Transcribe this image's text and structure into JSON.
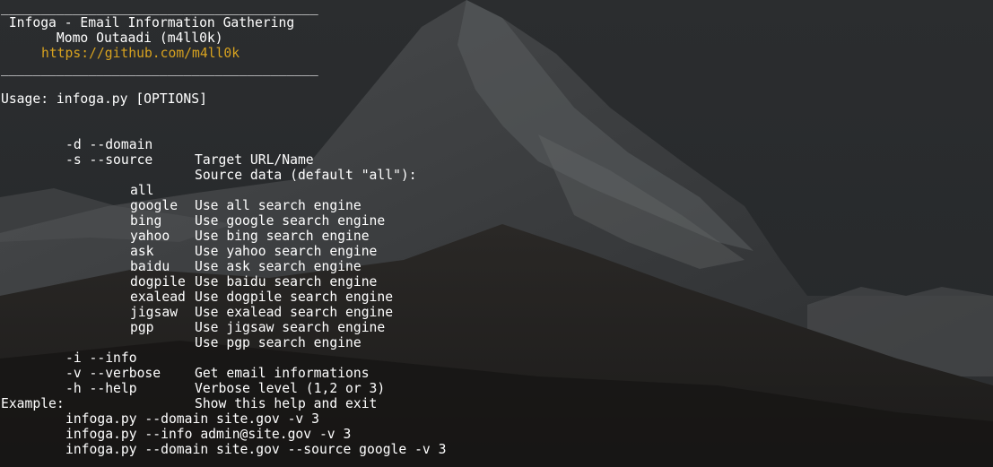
{
  "header": {
    "separator_top": "________________________________________",
    "title": " Infoga - Email Information Gathering",
    "author": "       Momo Outaadi (m4ll0k)",
    "url": "https://github.com/m4ll0k",
    "separator_bottom": "________________________________________"
  },
  "usage": "Usage: infoga.py [OPTIONS]",
  "main_options": [
    {
      "flag": "-d --domain",
      "desc": "Target URL/Name"
    },
    {
      "flag": "-s --source",
      "desc": "Source data (default \"all\"):"
    }
  ],
  "engines": [
    {
      "name": "all",
      "desc": "Use all search engine"
    },
    {
      "name": "google",
      "desc": "Use google search engine"
    },
    {
      "name": "bing",
      "desc": "Use bing search engine"
    },
    {
      "name": "yahoo",
      "desc": "Use yahoo search engine"
    },
    {
      "name": "ask",
      "desc": "Use ask search engine"
    },
    {
      "name": "baidu",
      "desc": "Use baidu search engine"
    },
    {
      "name": "dogpile",
      "desc": "Use dogpile search engine"
    },
    {
      "name": "exalead",
      "desc": "Use exalead search engine"
    },
    {
      "name": "jigsaw",
      "desc": "Use jigsaw search engine"
    },
    {
      "name": "pgp",
      "desc": "Use pgp search engine"
    }
  ],
  "extra_options": [
    {
      "flag": "-i --info",
      "desc": "Get email informations"
    },
    {
      "flag": "-v --verbose",
      "desc": "Verbose level (1,2 or 3)"
    },
    {
      "flag": "-h --help",
      "desc": "Show this help and exit"
    }
  ],
  "example_label": "Example:",
  "examples": [
    "infoga.py --domain site.gov -v 3",
    "infoga.py --info admin@site.gov -v 3",
    "infoga.py --domain site.gov --source google -v 3"
  ],
  "colors": {
    "text": "#ffffff",
    "link": "#d7a21f",
    "background": "#1d1f21"
  }
}
